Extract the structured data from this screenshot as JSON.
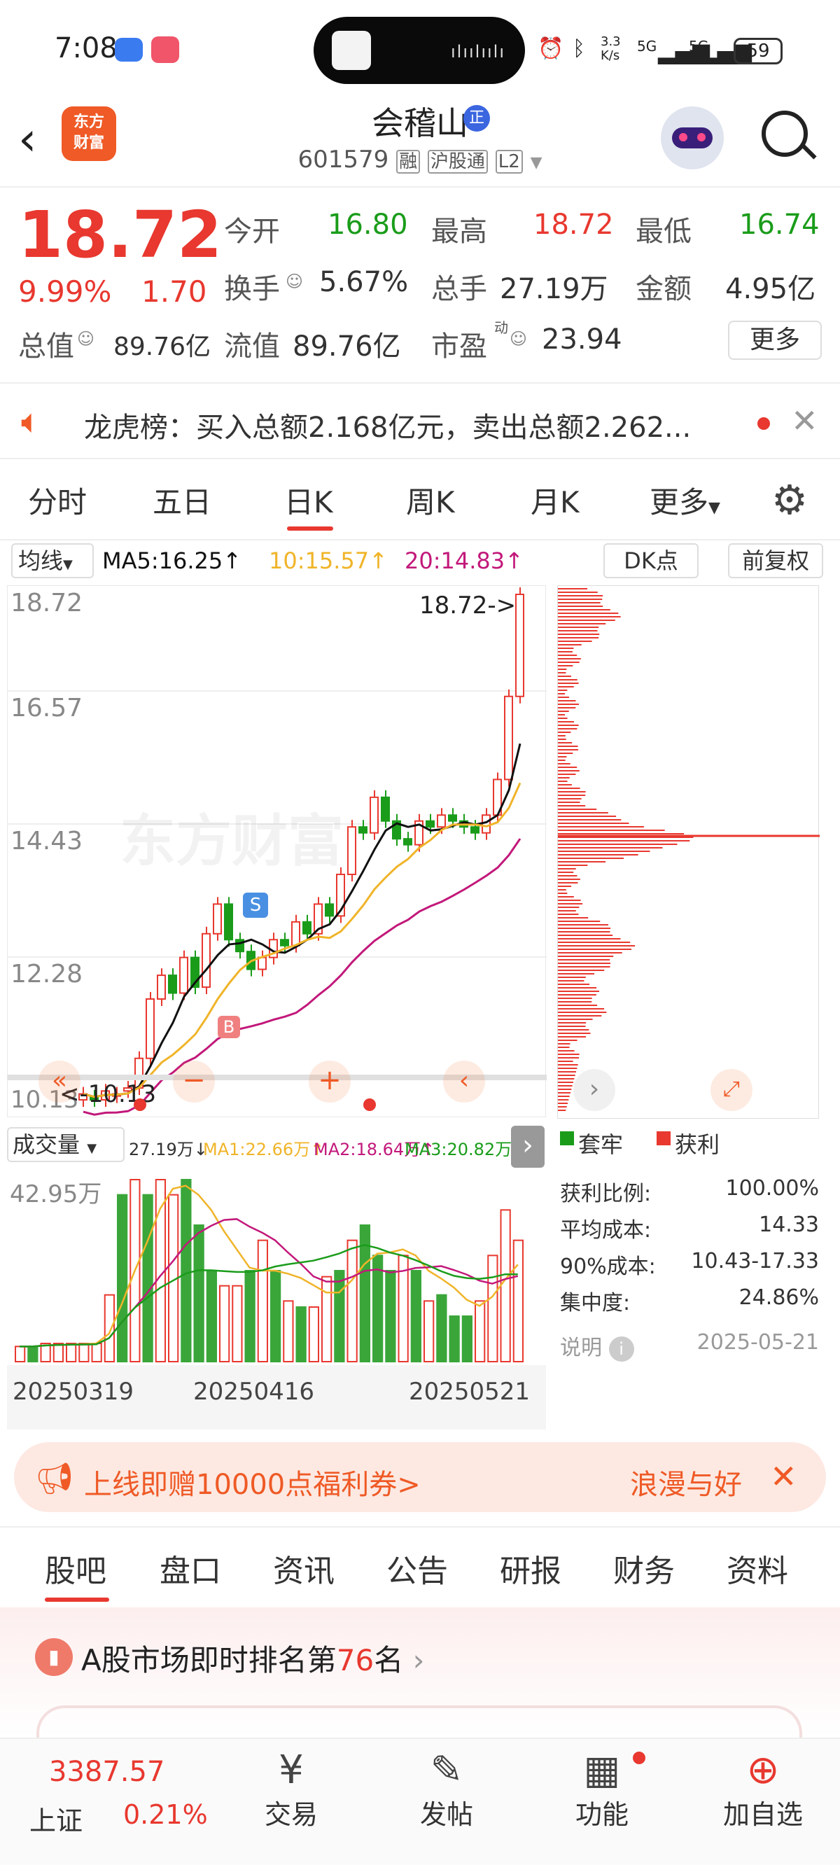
{
  "status_bar": {
    "time": "7:08",
    "network_speed": "3.3\nK/s",
    "battery": "59",
    "signal_1": "5G",
    "signal_2": "5G"
  },
  "header": {
    "logo_text": "东方\n财富",
    "title": "会稽山",
    "title_badge": "正",
    "code": "601579",
    "tags": [
      "融",
      "沪股通",
      "L2"
    ]
  },
  "quote": {
    "price": "18.72",
    "change_pct": "9.99%",
    "change": "1.70",
    "today_open_label": "今开",
    "today_open": "16.80",
    "high_label": "最高",
    "high": "18.72",
    "low_label": "最低",
    "low": "16.74",
    "turnover_label": "换手",
    "turnover": "5.67%",
    "volume_label": "总手",
    "volume": "27.19万",
    "amount_label": "金额",
    "amount": "4.95亿",
    "mktcap_label": "总值",
    "mktcap": "89.76亿",
    "float_label": "流值",
    "float": "89.76亿",
    "pe_label": "市盈",
    "pe_sup": "动",
    "pe": "23.94",
    "more_label": "更多"
  },
  "notice": {
    "text": "龙虎榜：买入总额2.168亿元，卖出总额2.262..."
  },
  "tabs": [
    "分时",
    "五日",
    "日K",
    "周K",
    "月K",
    "更多"
  ],
  "active_tab": "日K",
  "kline": {
    "ma_selector": "均线",
    "ma5": "MA5:16.25↑",
    "ma10": "10:15.57↑",
    "ma20": "20:14.83↑",
    "dk_button": "DK点",
    "adjust_button": "前复权",
    "price_labels": [
      "18.72",
      "16.57",
      "14.43",
      "12.28",
      "10.13"
    ],
    "last_price_marker": "18.72->",
    "low_marker": "10.13",
    "signal_s": "S",
    "signal_b": "B",
    "watermark": "东方财富"
  },
  "volume": {
    "selector": "成交量",
    "total": "27.19万↓",
    "ma1": "MA1:22.66万↑",
    "ma2": "MA2:18.64万↑",
    "ma3": "MA3:20.82万↑",
    "max_label": "42.95万",
    "dates": [
      "20250319",
      "20250416",
      "20250521"
    ]
  },
  "chips": {
    "legend_trapped": "套牢",
    "legend_profit": "获利",
    "rows": [
      {
        "label": "获利比例:",
        "value": "100.00%"
      },
      {
        "label": "平均成本:",
        "value": "14.33"
      },
      {
        "label": "90%成本:",
        "value": "10.43-17.33"
      },
      {
        "label": "集中度:",
        "value": "24.86%"
      }
    ],
    "note_label": "说明",
    "date": "2025-05-21"
  },
  "promo": {
    "left_text": "上线即赠10000点福利券>",
    "right_text": "浪漫与好"
  },
  "sub_tabs": [
    "股吧",
    "盘口",
    "资讯",
    "公告",
    "研报",
    "财务",
    "资料"
  ],
  "active_sub_tab": "股吧",
  "ranking": {
    "prefix": "A股市场即时排名第",
    "rank": "76",
    "suffix": "名"
  },
  "bottom": {
    "index_value": "3387.57",
    "index_name": "上证",
    "index_change": "0.21%",
    "items": [
      "交易",
      "发帖",
      "功能",
      "加自选"
    ]
  },
  "colors": {
    "red": "#e8382f",
    "green": "#1a9c1a",
    "ma5": "#111111",
    "ma10": "#f0b429",
    "ma20": "#c2187a"
  }
}
